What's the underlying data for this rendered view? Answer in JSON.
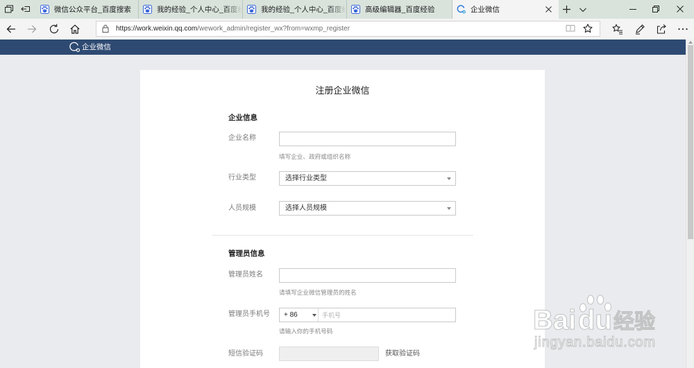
{
  "browser": {
    "tabs": [
      {
        "title": "微信公众平台_百度搜索",
        "icon": "baidu-paw-icon"
      },
      {
        "title": "我的经验_个人中心_百度经",
        "icon": "baidu-paw-icon"
      },
      {
        "title": "我的经验_个人中心_百度经",
        "icon": "baidu-paw-icon"
      },
      {
        "title": "高级编辑器_百度经验",
        "icon": "baidu-paw-icon"
      },
      {
        "title": "企业微信",
        "icon": "wework-icon",
        "active": true
      }
    ],
    "address": {
      "url_origin": "https://work.weixin.qq.com",
      "url_path": "/wework_admin/register_wx?from=wxmp_register",
      "secure_icon": "lock-icon"
    },
    "toolbar_icons": [
      "back-icon",
      "forward-icon",
      "refresh-icon",
      "home-icon",
      "reading-view-icon",
      "favorite-star-icon",
      "favorites-hub-icon",
      "add-notes-icon",
      "share-icon",
      "more-icon"
    ],
    "window_controls": [
      "minimize-icon",
      "restore-icon",
      "close-icon"
    ]
  },
  "site_header": {
    "brand": "企业微信",
    "logo_icon": "wework-logo-icon"
  },
  "form": {
    "title": "注册企业微信",
    "company": {
      "heading": "企业信息",
      "name_label": "企业名称",
      "name_hint": "填写企业、政府或组织名称",
      "industry_label": "行业类型",
      "industry_selected": "选择行业类型",
      "size_label": "人员规模",
      "size_selected": "选择人员规模"
    },
    "admin": {
      "heading": "管理员信息",
      "name_label": "管理员姓名",
      "name_hint": "请填写企业微信管理员的姓名",
      "phone_label": "管理员手机号",
      "country_code": "+ 86",
      "phone_placeholder": "手机号",
      "phone_hint": "请输入你的手机号码",
      "sms_label": "短信验证码",
      "sms_button": "获取验证码"
    }
  },
  "watermark": {
    "brand_left": "Bai",
    "brand_right": "du",
    "product": "经验",
    "site": "jingyan.baidu.com"
  },
  "colors": {
    "tab_bar": "#d9e3dc",
    "site_header": "#2e4a72",
    "page_background": "#e9ebee",
    "card": "#ffffff"
  }
}
